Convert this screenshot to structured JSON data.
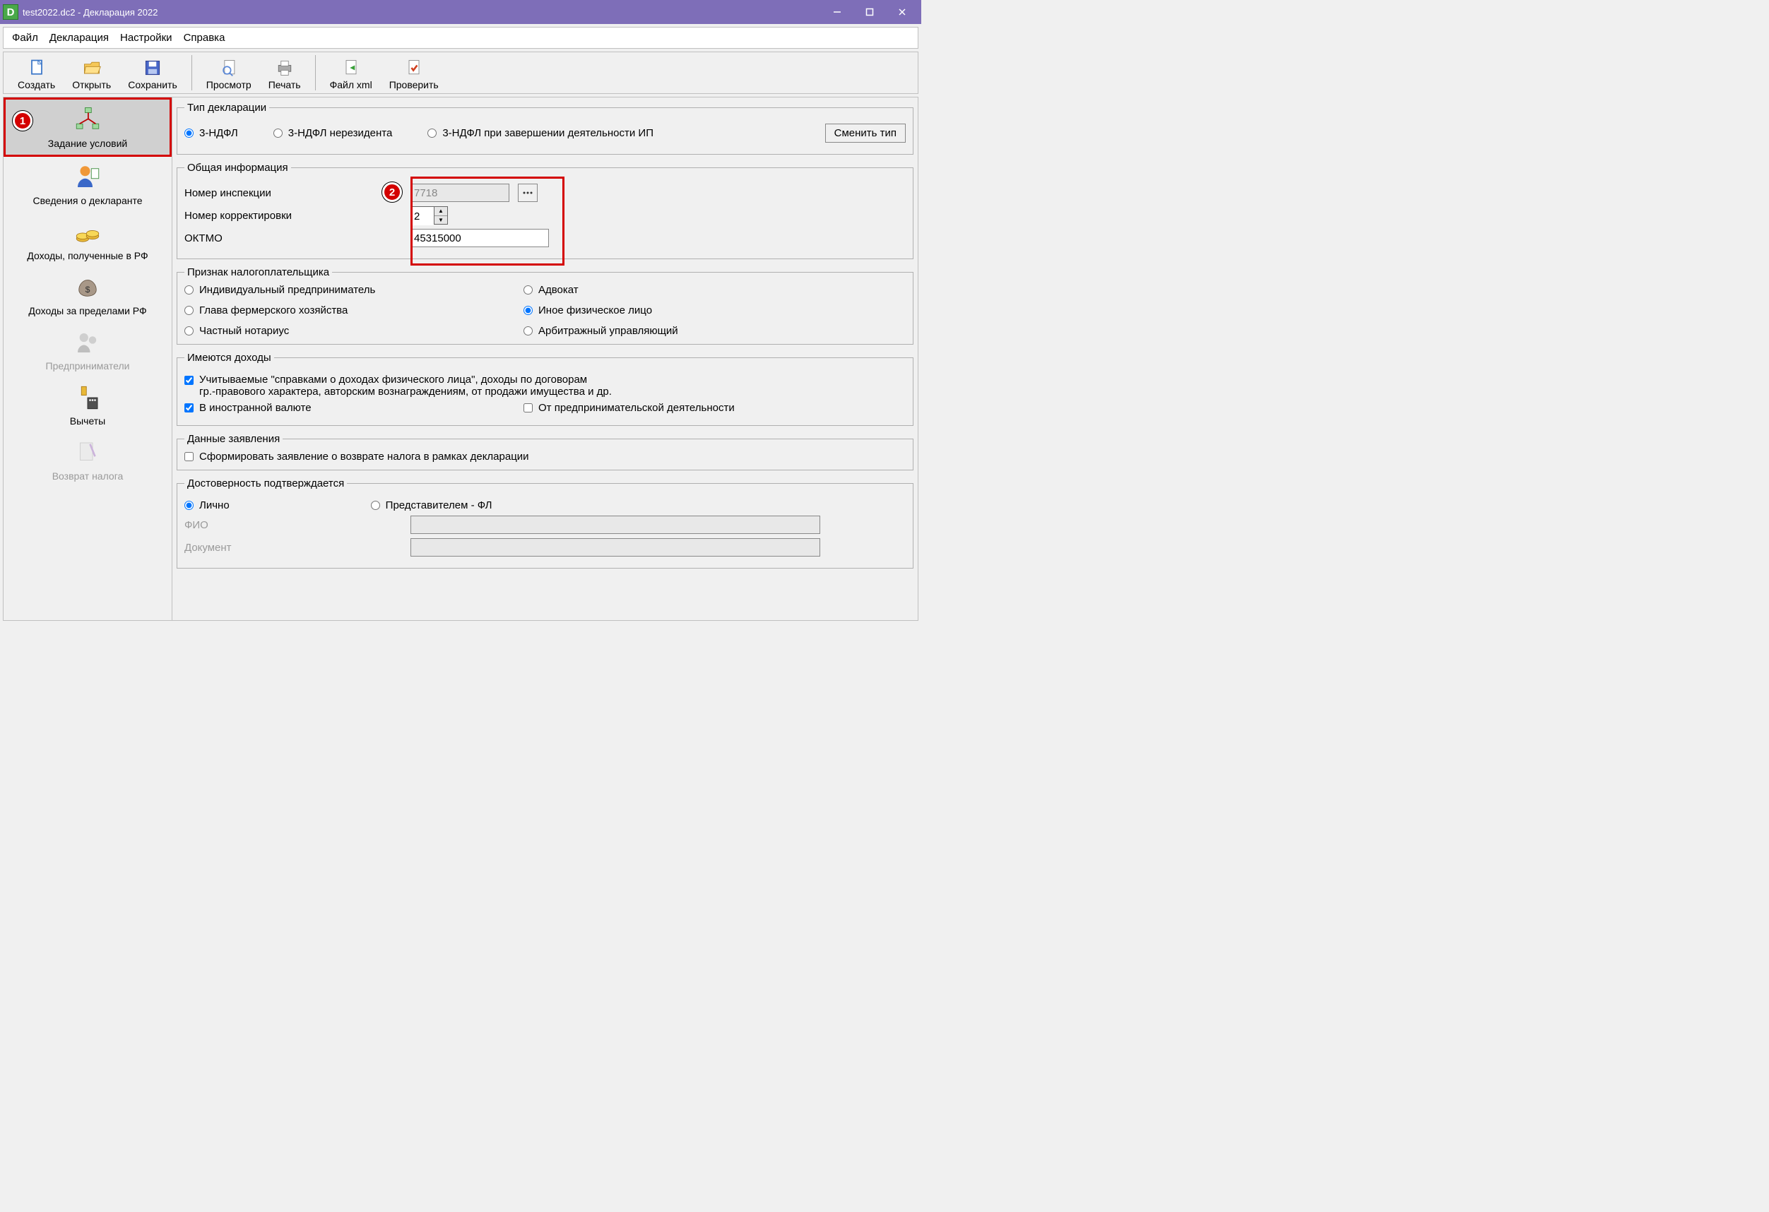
{
  "window": {
    "title": "test2022.dc2 - Декларация 2022"
  },
  "menu": {
    "file": "Файл",
    "declaration": "Декларация",
    "settings": "Настройки",
    "help": "Справка"
  },
  "toolbar": {
    "create": "Создать",
    "open": "Открыть",
    "save": "Сохранить",
    "preview": "Просмотр",
    "print": "Печать",
    "filexml": "Файл xml",
    "check": "Проверить"
  },
  "sidebar": {
    "conditions": "Задание условий",
    "declarant": "Сведения о декларанте",
    "income_rf": "Доходы, полученные в РФ",
    "income_abroad": "Доходы за пределами РФ",
    "entrepreneurs": "Предприниматели",
    "deductions": "Вычеты",
    "refund": "Возврат налога"
  },
  "markers": {
    "m1": "1",
    "m2": "2"
  },
  "decl_type": {
    "legend": "Тип декларации",
    "opt1": "3-НДФЛ",
    "opt2": "3-НДФЛ нерезидента",
    "opt3": "3-НДФЛ при завершении деятельности ИП",
    "change_btn": "Сменить тип"
  },
  "general": {
    "legend": "Общая информация",
    "inspection_lbl": "Номер инспекции",
    "inspection_val": "7718",
    "correction_lbl": "Номер корректировки",
    "correction_val": "2",
    "oktmo_lbl": "ОКТМО",
    "oktmo_val": "45315000"
  },
  "taxpayer": {
    "legend": "Признак налогоплательщика",
    "ip": "Индивидуальный предприниматель",
    "lawyer": "Адвокат",
    "farm": "Глава фермерского хозяйства",
    "other": "Иное физическое лицо",
    "notary": "Частный нотариус",
    "arbitr": "Арбитражный управляющий"
  },
  "income": {
    "legend": "Имеются доходы",
    "chk1_line1": "Учитываемые \"справками о доходах физического лица\", доходы по договорам",
    "chk1_line2": "гр.-правового характера, авторским вознаграждениям, от продажи имущества и др.",
    "chk2": "В иностранной валюте",
    "chk3": "От предпринимательской деятельности"
  },
  "application": {
    "legend": "Данные заявления",
    "chk": "Сформировать заявление о возврате налога в рамках декларации"
  },
  "reliability": {
    "legend": "Достоверность подтверждается",
    "self": "Лично",
    "repr": "Представителем - ФЛ",
    "fio": "ФИО",
    "doc": "Документ"
  }
}
